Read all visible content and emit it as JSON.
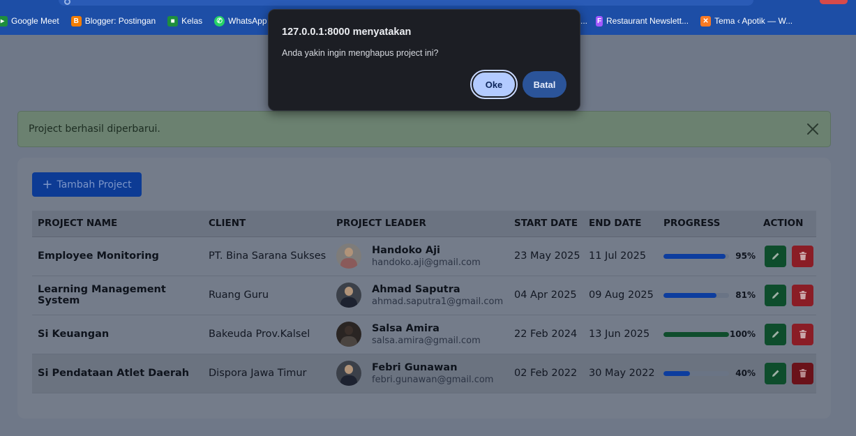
{
  "browser": {
    "bookmarks": [
      {
        "label": "Google Meet",
        "icon": "google-meet-icon",
        "color": "#1e8e3e"
      },
      {
        "label": "Blogger: Postingan",
        "icon": "blogger-icon",
        "color": "#f57d00"
      },
      {
        "label": "Kelas",
        "icon": "classroom-icon",
        "color": "#1e8e3e"
      },
      {
        "label": "WhatsApp",
        "icon": "whatsapp-icon",
        "color": "#25d366"
      }
    ],
    "bookmarks_right": [
      {
        "label": "...",
        "icon": "ellipsis-icon",
        "color": "#1d4ea6"
      },
      {
        "label": "Restaurant Newslett...",
        "icon": "figma-icon",
        "color": "#a259ff"
      },
      {
        "label": "Tema ‹ Apotik — W...",
        "icon": "xampp-icon",
        "color": "#fb7a24"
      }
    ]
  },
  "alert": {
    "message": "Project berhasil diperbarui."
  },
  "toolbar": {
    "add_label": "Tambah Project"
  },
  "table": {
    "headers": [
      "PROJECT NAME",
      "CLIENT",
      "PROJECT LEADER",
      "START DATE",
      "END DATE",
      "PROGRESS",
      "ACTION"
    ],
    "rows": [
      {
        "name": "Employee Monitoring",
        "client": "PT. Bina Sarana Sukses",
        "leader": "Handoko Aji",
        "email": "handoko.aji@gmail.com",
        "start": "23 May 2025",
        "end": "11 Jul 2025",
        "progress": 95,
        "progress_label": "95%"
      },
      {
        "name": "Learning Management System",
        "client": "Ruang Guru",
        "leader": "Ahmad Saputra",
        "email": "ahmad.saputra1@gmail.com",
        "start": "04 Apr 2025",
        "end": "09 Aug 2025",
        "progress": 81,
        "progress_label": "81%"
      },
      {
        "name": "Si Keuangan",
        "client": "Bakeuda Prov.Kalsel",
        "leader": "Salsa Amira",
        "email": "salsa.amira@gmail.com",
        "start": "22 Feb 2024",
        "end": "13 Jun 2025",
        "progress": 100,
        "progress_label": "100%"
      },
      {
        "name": "Si Pendataan Atlet Daerah",
        "client": "Dispora Jawa Timur",
        "leader": "Febri Gunawan",
        "email": "febri.gunawan@gmail.com",
        "start": "02 Feb 2022",
        "end": "30 May 2022",
        "progress": 40,
        "progress_label": "40%"
      }
    ]
  },
  "dialog": {
    "title": "127.0.0.1:8000 menyatakan",
    "message": "Anda yakin ingin menghapus project ini?",
    "ok_label": "Oke",
    "cancel_label": "Batal"
  }
}
